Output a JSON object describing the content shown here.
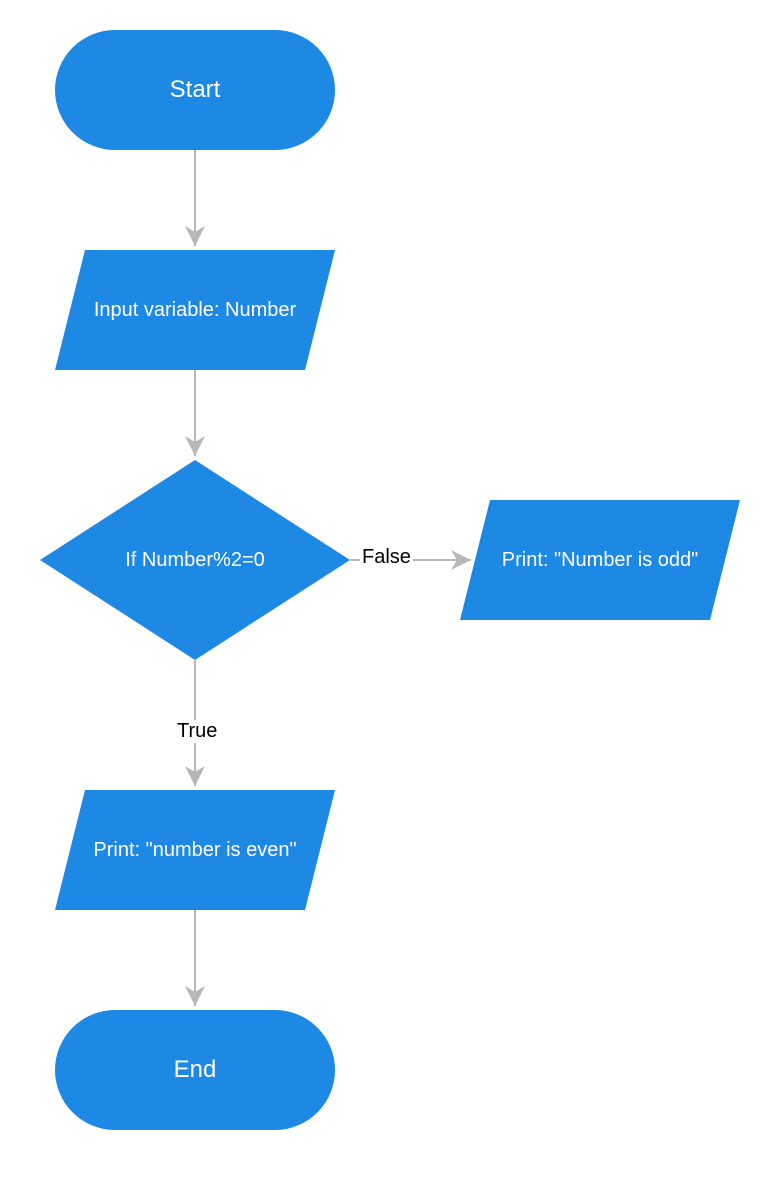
{
  "nodes": {
    "start": {
      "label": "Start"
    },
    "input": {
      "label": "Input variable: Number"
    },
    "decision": {
      "label": "If Number%2=0"
    },
    "printEven": {
      "label": "Print: \"number is even\""
    },
    "printOdd": {
      "label": "Print: \"Number is odd\""
    },
    "end": {
      "label": "End"
    }
  },
  "edges": {
    "true": {
      "label": "True"
    },
    "false": {
      "label": "False"
    }
  },
  "colors": {
    "fill": "#1e88e5",
    "stroke": "#b7b7b7",
    "arrow": "#b7b7b7"
  }
}
